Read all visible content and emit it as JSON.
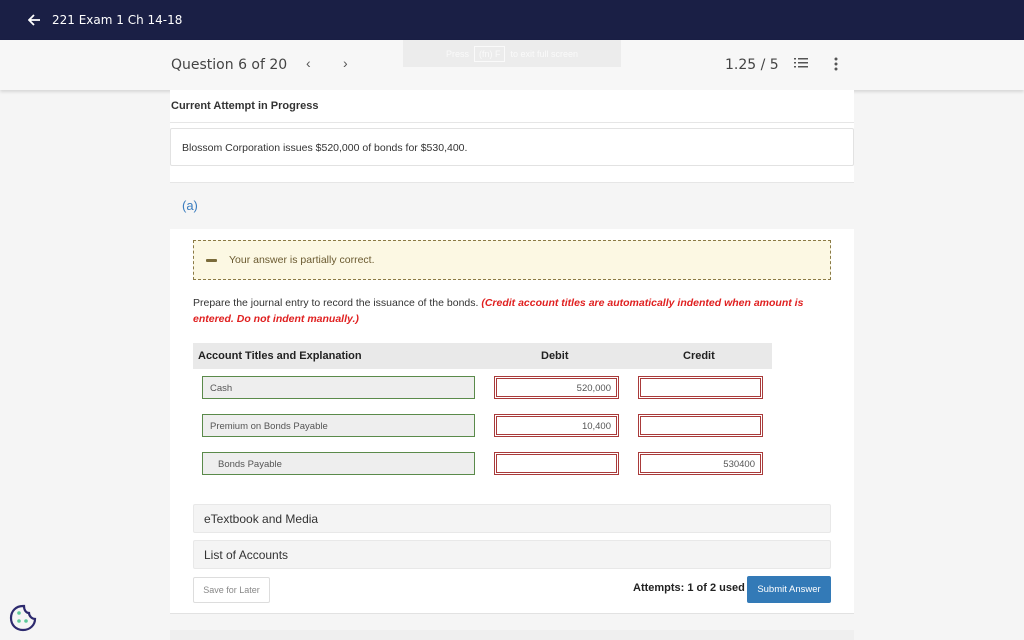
{
  "topbar": {
    "back_icon": "arrow-left-icon",
    "title": "221 Exam 1 Ch 14-18"
  },
  "question_bar": {
    "question_label": "Question 6 of 20",
    "prev_icon": "chevron-left-icon",
    "next_icon": "chevron-right-icon",
    "fullscreen_hint_press": "Press",
    "fullscreen_hint_key": "(fn) F",
    "fullscreen_hint_rest": "to exit full screen",
    "score": "1.25 / 5",
    "list_icon": "numbered-list-icon",
    "more_icon": "more-vertical-icon"
  },
  "main": {
    "attempt_heading": "Current Attempt in Progress",
    "problem_text": "Blossom Corporation issues $520,000 of bonds for $530,400.",
    "part_label": "(a)",
    "feedback": {
      "icon": "minus-icon",
      "text": "Your answer is partially correct."
    },
    "instruction": {
      "plain": "Prepare the journal entry to record the issuance of the bonds. ",
      "emphasis": "(Credit account titles are automatically indented when amount is entered. Do not indent manually.)"
    },
    "journal": {
      "headers": {
        "account": "Account Titles and Explanation",
        "debit": "Debit",
        "credit": "Credit"
      },
      "rows": [
        {
          "account": "Cash",
          "debit": "520,000",
          "credit": ""
        },
        {
          "account": "Premium on Bonds Payable",
          "debit": "10,400",
          "credit": ""
        },
        {
          "account": "Bonds Payable",
          "debit": "",
          "credit": "530400"
        }
      ]
    },
    "accordions": [
      {
        "label": "eTextbook and Media"
      },
      {
        "label": "List of Accounts"
      }
    ],
    "save_label": "Save for Later",
    "attempts_text": "Attempts: 1 of 2 used",
    "submit_label": "Submit Answer"
  },
  "colors": {
    "topbar_bg": "#1a1f45",
    "accent_blue": "#337ab7",
    "instruction_red": "#e02020",
    "incorrect_border": "#a93a3a",
    "correct_border": "#5a8a4a",
    "feedback_bg": "#fcf8e3"
  },
  "cookie_icon": "cookie-settings-icon"
}
